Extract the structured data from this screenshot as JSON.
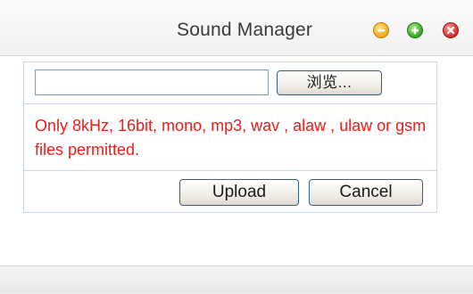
{
  "window": {
    "title": "Sound Manager",
    "controls": [
      {
        "icon": "minimize-icon",
        "color": "#f2a81d"
      },
      {
        "icon": "maximize-icon",
        "color": "#35a51d"
      },
      {
        "icon": "close-icon",
        "color": "#d12c2c"
      }
    ]
  },
  "upload_form": {
    "file_input_value": "",
    "browse_label": "浏览...",
    "note": "Only 8kHz, 16bit, mono, mp3, wav , alaw , ulaw or gsm files permitted.",
    "upload_label": "Upload",
    "cancel_label": "Cancel"
  },
  "colors": {
    "note_text": "#e8201c",
    "panel_border": "#c9d6e6",
    "button_border": "#3c5a86"
  }
}
